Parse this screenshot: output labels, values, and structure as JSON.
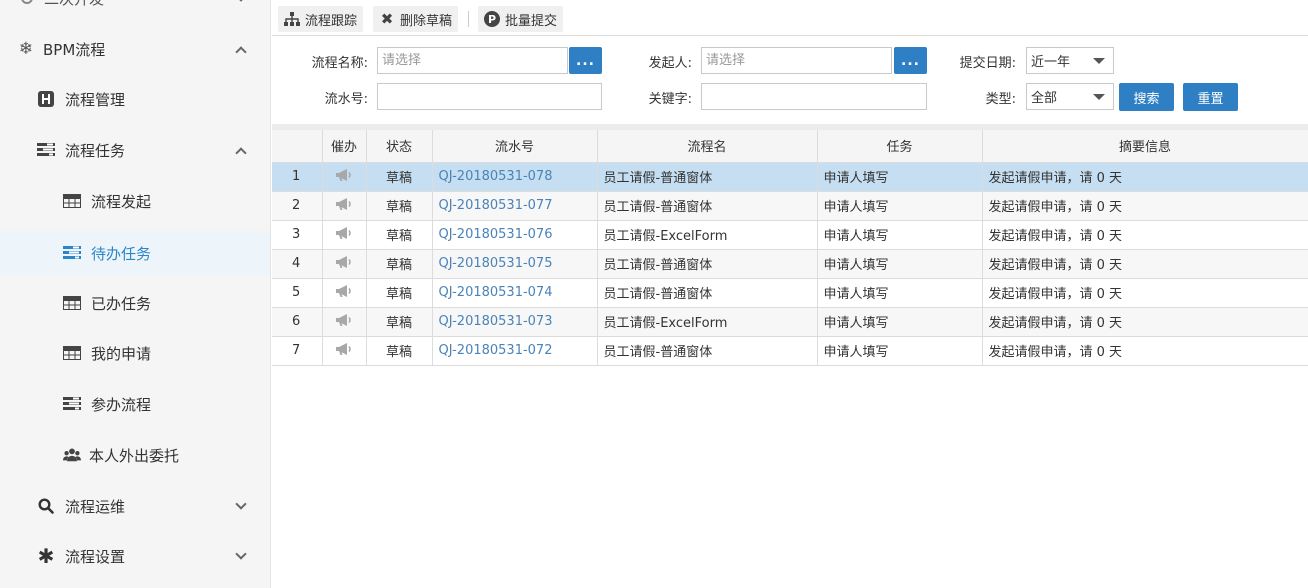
{
  "sidebar": {
    "top_partial_label": "二次开发",
    "items": [
      {
        "label": "BPM流程",
        "icon": "snowflake-icon",
        "expanded": true
      },
      {
        "label": "流程管理",
        "icon": "h-square-icon"
      },
      {
        "label": "流程任务",
        "icon": "tasks-list-icon",
        "expanded": true
      },
      {
        "label": "流程发起",
        "icon": "table-grid-icon"
      },
      {
        "label": "待办任务",
        "icon": "tasks-list-icon",
        "active": true
      },
      {
        "label": "已办任务",
        "icon": "table-grid-icon"
      },
      {
        "label": "我的申请",
        "icon": "table-grid-icon"
      },
      {
        "label": "参办流程",
        "icon": "tasks-list-icon"
      },
      {
        "label": "本人外出委托",
        "icon": "users-icon"
      },
      {
        "label": "流程运维",
        "icon": "search-icon",
        "expanded": false
      },
      {
        "label": "流程设置",
        "icon": "asterisk-icon",
        "expanded": false
      }
    ]
  },
  "toolbar": {
    "track_label": "流程跟踪",
    "delete_label": "删除草稿",
    "batch_label": "批量提交"
  },
  "search": {
    "process_name_label": "流程名称:",
    "process_name_placeholder": "请选择",
    "initiator_label": "发起人:",
    "initiator_placeholder": "请选择",
    "dots_label": "...",
    "submit_date_label": "提交日期:",
    "submit_date_value": "近一年",
    "serial_label": "流水号:",
    "keyword_label": "关键字:",
    "type_label": "类型:",
    "type_value": "全部",
    "search_button": "搜索",
    "reset_button": "重置"
  },
  "table": {
    "columns": [
      "催办",
      "状态",
      "流水号",
      "流程名",
      "任务",
      "摘要信息"
    ],
    "rows": [
      {
        "num": "1",
        "state": "草稿",
        "serial": "QJ-20180531-078",
        "process": "员工请假-普通窗体",
        "task": "申请人填写",
        "summary": "发起请假申请，请 0 天"
      },
      {
        "num": "2",
        "state": "草稿",
        "serial": "QJ-20180531-077",
        "process": "员工请假-普通窗体",
        "task": "申请人填写",
        "summary": "发起请假申请，请 0 天"
      },
      {
        "num": "3",
        "state": "草稿",
        "serial": "QJ-20180531-076",
        "process": "员工请假-ExcelForm",
        "task": "申请人填写",
        "summary": "发起请假申请，请 0 天"
      },
      {
        "num": "4",
        "state": "草稿",
        "serial": "QJ-20180531-075",
        "process": "员工请假-普通窗体",
        "task": "申请人填写",
        "summary": "发起请假申请，请 0 天"
      },
      {
        "num": "5",
        "state": "草稿",
        "serial": "QJ-20180531-074",
        "process": "员工请假-普通窗体",
        "task": "申请人填写",
        "summary": "发起请假申请，请 0 天"
      },
      {
        "num": "6",
        "state": "草稿",
        "serial": "QJ-20180531-073",
        "process": "员工请假-ExcelForm",
        "task": "申请人填写",
        "summary": "发起请假申请，请 0 天"
      },
      {
        "num": "7",
        "state": "草稿",
        "serial": "QJ-20180531-072",
        "process": "员工请假-普通窗体",
        "task": "申请人填写",
        "summary": "发起请假申请，请 0 天"
      }
    ]
  },
  "colors": {
    "accent": "#2f7fc4",
    "active_text": "#2a86c9",
    "selected_row": "#c5def1",
    "link": "#4a83b8"
  }
}
